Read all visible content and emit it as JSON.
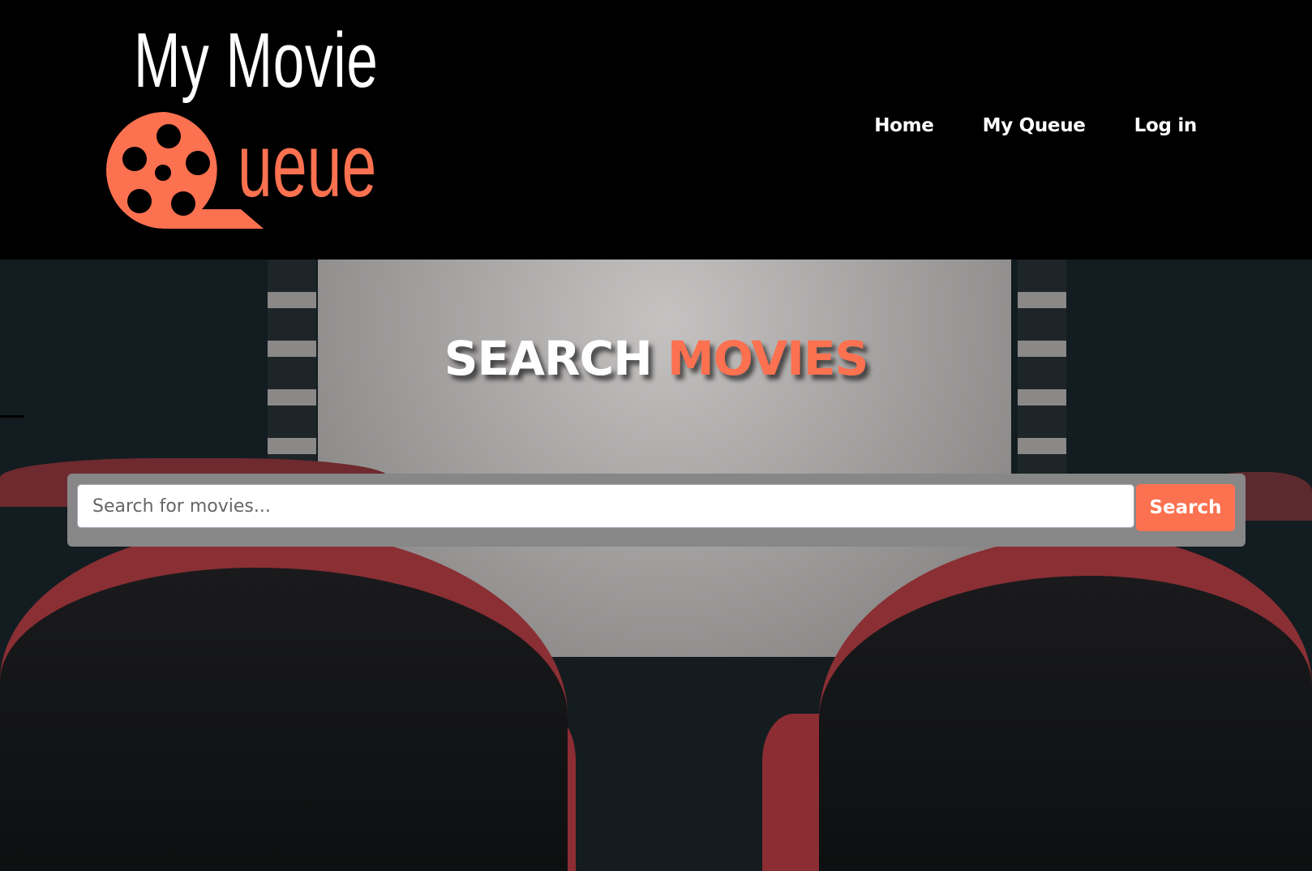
{
  "logo": {
    "line1": "My Movie",
    "line2": "ueue",
    "icon": "film-reel-icon"
  },
  "nav": {
    "items": [
      {
        "label": "Home"
      },
      {
        "label": "My Queue"
      },
      {
        "label": "Log in"
      }
    ]
  },
  "hero": {
    "title_plain": "SEARCH",
    "title_accent": "MOVIES"
  },
  "search": {
    "placeholder": "Search for movies...",
    "value": "",
    "button_label": "Search"
  },
  "colors": {
    "accent": "#fc7150",
    "header_bg": "#000000",
    "panel": "#878787"
  }
}
